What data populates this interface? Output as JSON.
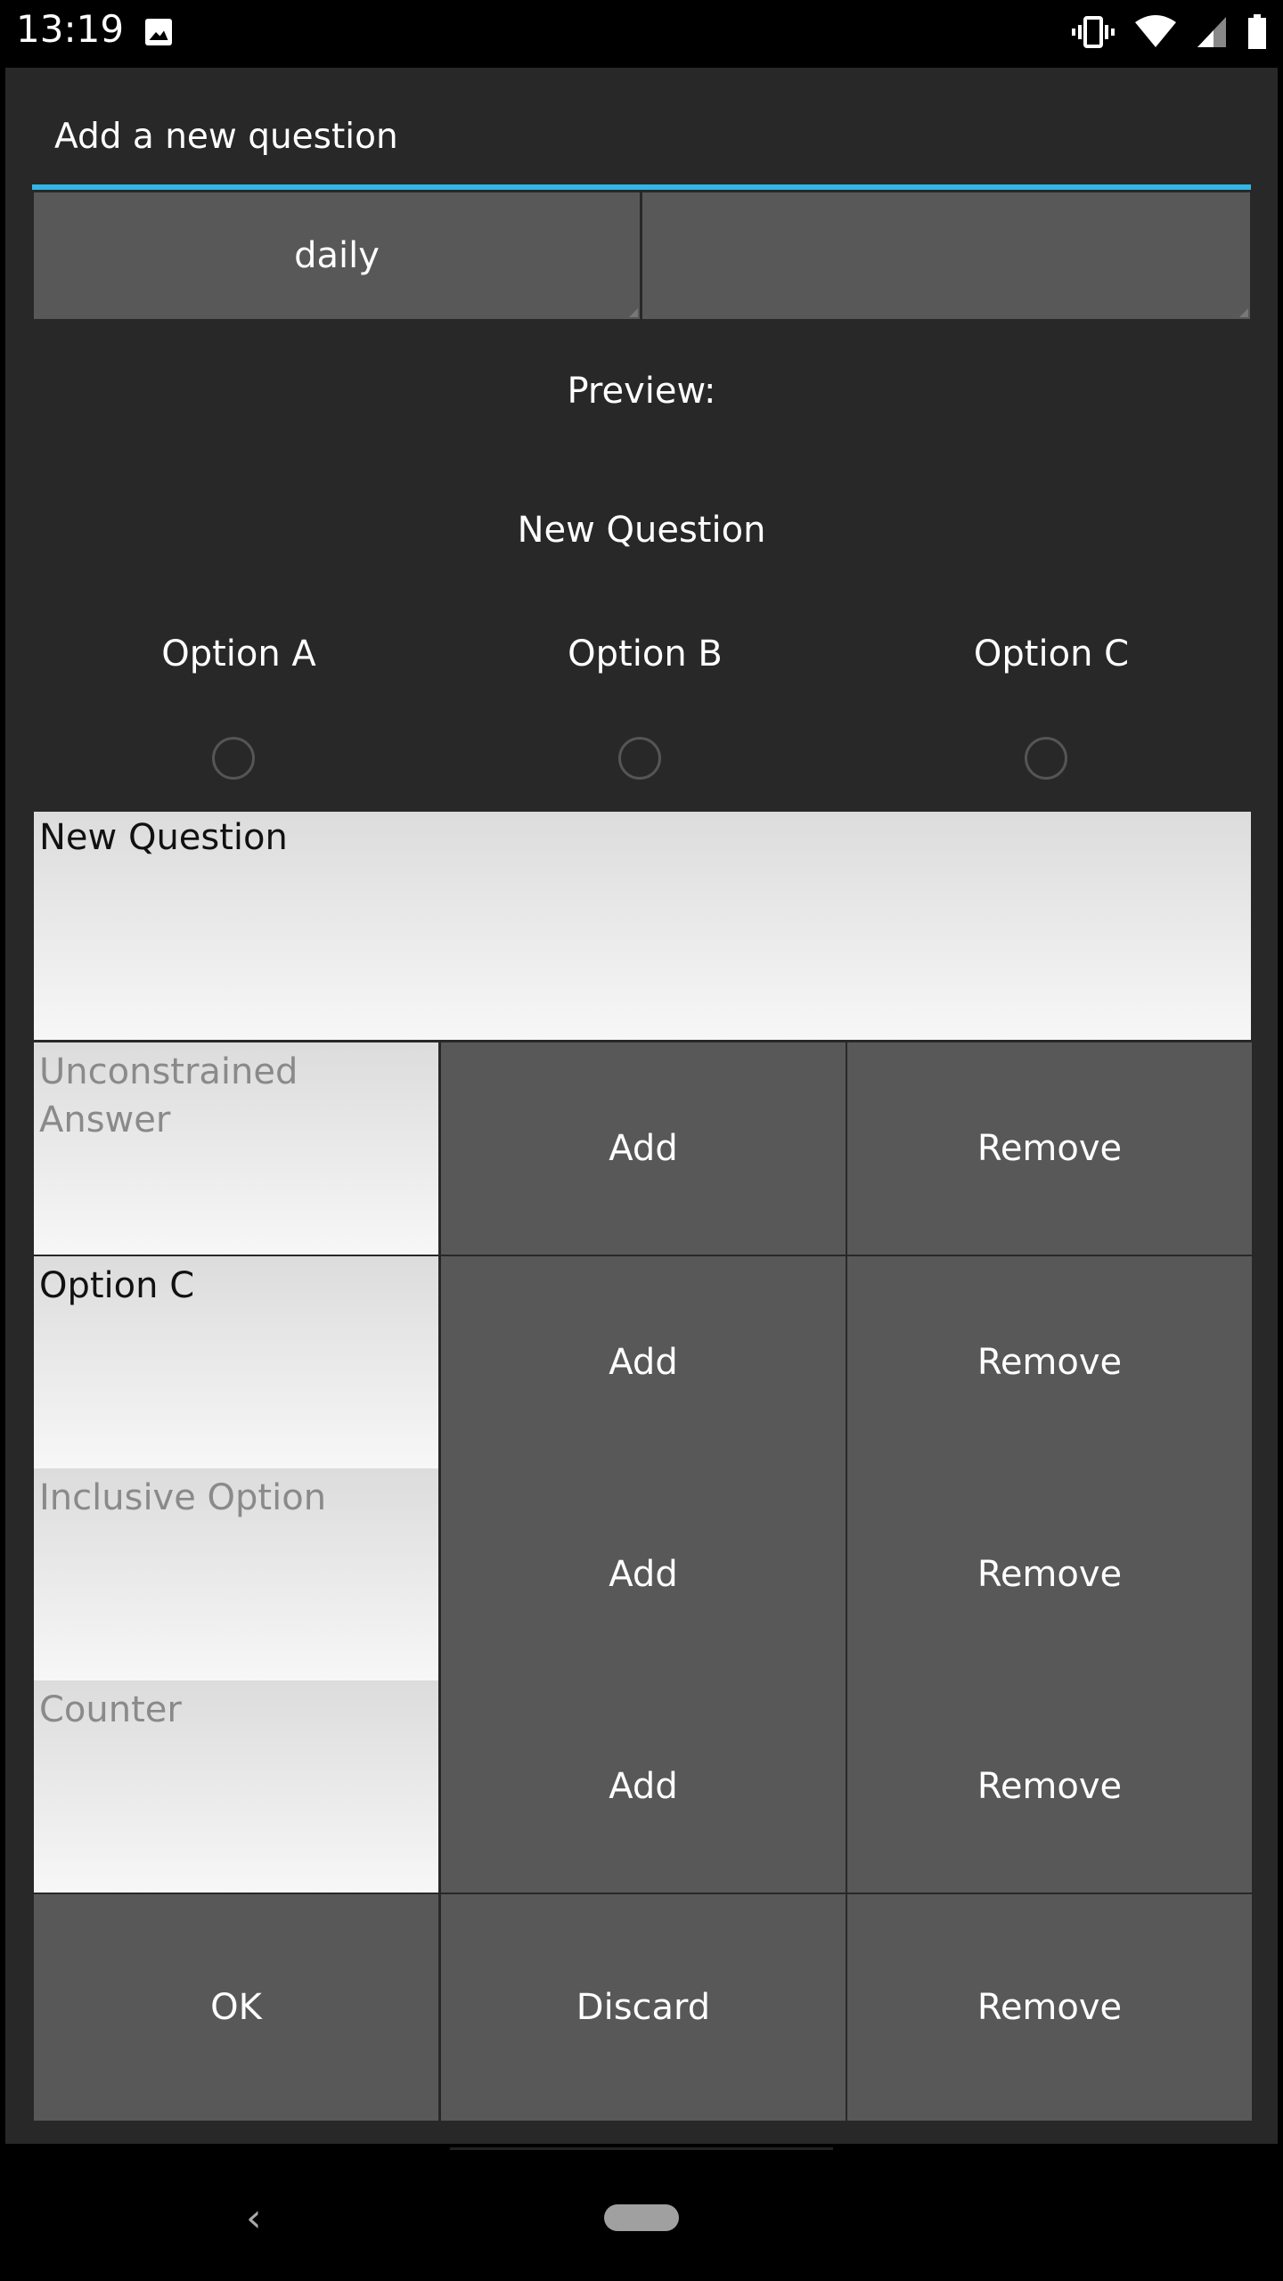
{
  "status_bar": {
    "time": "13:19",
    "icons": [
      "image-icon",
      "vibrate-icon",
      "wifi-icon",
      "signal-icon",
      "battery-icon"
    ]
  },
  "dialog": {
    "title": "Add a new question",
    "accent_color": "#33b5e5",
    "frequency_spinner": {
      "value": "daily"
    },
    "second_spinner": {
      "value": ""
    }
  },
  "preview": {
    "label": "Preview:",
    "question": "New Question",
    "options": [
      "Option A",
      "Option B",
      "Option C"
    ]
  },
  "question_field": {
    "value": "New Question"
  },
  "rows": [
    {
      "field_value": "",
      "field_hint": "Unconstrained\nAnswer",
      "add_label": "Add",
      "remove_label": "Remove"
    },
    {
      "field_value": "Option C",
      "field_hint": "",
      "add_label": "Add",
      "remove_label": "Remove"
    },
    {
      "field_value": "",
      "field_hint": "Inclusive Option",
      "add_label": "Add",
      "remove_label": "Remove"
    },
    {
      "field_value": "",
      "field_hint": "Counter",
      "add_label": "Add",
      "remove_label": "Remove"
    }
  ],
  "actions": {
    "ok": "OK",
    "discard": "Discard",
    "remove": "Remove"
  },
  "nav": {
    "back": "‹"
  }
}
